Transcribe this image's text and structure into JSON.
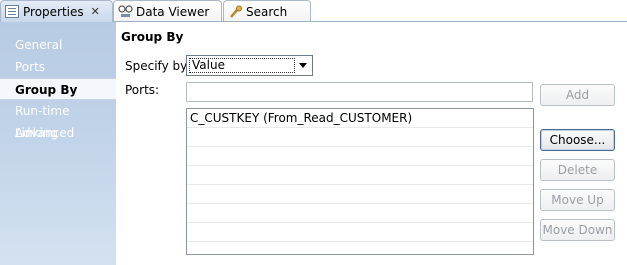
{
  "tabs": [
    {
      "label": "Properties",
      "icon": "properties-icon",
      "active": true,
      "closable": true
    },
    {
      "label": "Data Viewer",
      "icon": "data-viewer-icon",
      "active": false
    },
    {
      "label": "Search",
      "icon": "search-icon",
      "active": false
    }
  ],
  "nav": {
    "items": [
      {
        "label": "General"
      },
      {
        "label": "Ports"
      },
      {
        "label": "Group By",
        "selected": true
      },
      {
        "label": "Run-time Linking"
      },
      {
        "label": "Advanced"
      }
    ]
  },
  "main": {
    "title": "Group By",
    "specify_by_label": "Specify by:",
    "specify_by_value": "Value",
    "ports_label": "Ports:",
    "ports_input_value": "",
    "ports_rows": [
      "C_CUSTKEY (From_Read_CUSTOMER)",
      "",
      "",
      "",
      "",
      "",
      "",
      ""
    ]
  },
  "buttons": {
    "add": "Add",
    "choose": "Choose...",
    "delete": "Delete",
    "move_up": "Move Up",
    "move_down": "Move Down"
  },
  "colors": {
    "nav_background": "#bfd2e8",
    "nav_text": "#ffffff",
    "tab_active": "#c9d8ea"
  }
}
